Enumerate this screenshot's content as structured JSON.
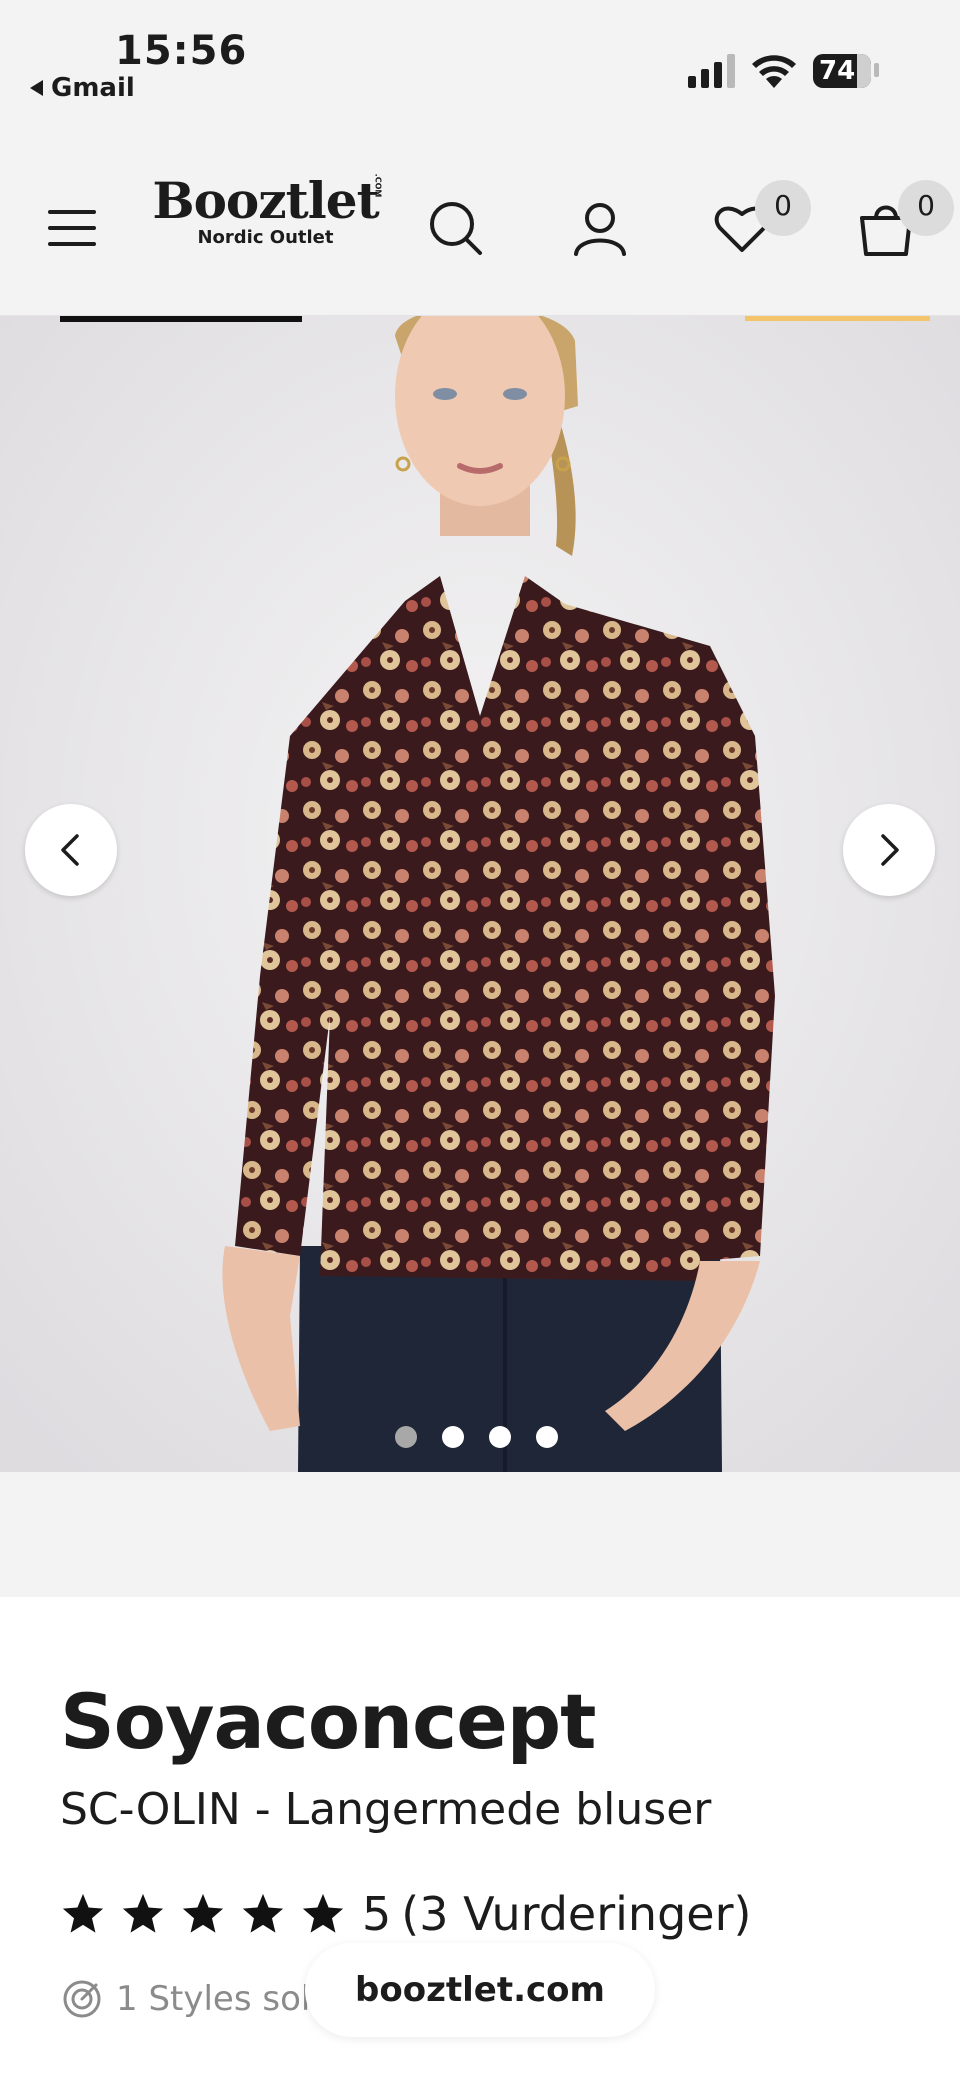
{
  "status_bar": {
    "time": "15:56",
    "back_app": "Gmail",
    "battery": "74"
  },
  "header": {
    "logo_word": "Booztlet",
    "logo_com": ".COM",
    "logo_sub": "Nordic Outlet",
    "wishlist_count": "0",
    "cart_count": "0",
    "icons": [
      "menu-icon",
      "search-icon",
      "user-icon",
      "heart-icon",
      "bag-icon"
    ]
  },
  "gallery": {
    "dot_count": 4,
    "active_dot": 1
  },
  "product": {
    "brand": "Soyaconcept",
    "name": "SC-OLIN - Langermede bluser",
    "rating_value": "5",
    "rating_count": "(3 Vurderinger)",
    "stars": 5,
    "sold_text": "1 Styles sol"
  },
  "browser": {
    "url": "booztlet.com"
  },
  "colors": {
    "accent_yellow": "#f3c46c",
    "text": "#1c1c1c"
  }
}
